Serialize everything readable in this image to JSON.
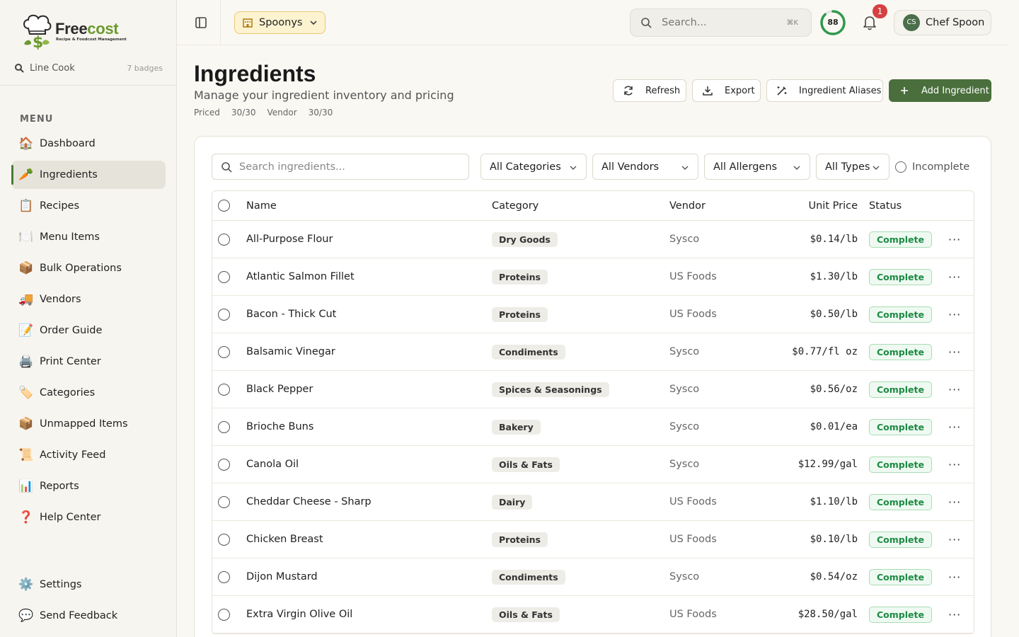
{
  "brand": {
    "name_main": "Free",
    "name_accent": "cost",
    "tagline": "Recipe & Foodcost Management"
  },
  "rank": {
    "label": "Line Cook",
    "badges": "7 badges"
  },
  "menu_label": "MENU",
  "nav": [
    {
      "icon": "🏠",
      "label": "Dashboard",
      "name": "dashboard",
      "active": false
    },
    {
      "icon": "🥕",
      "label": "Ingredients",
      "name": "ingredients",
      "active": true
    },
    {
      "icon": "📋",
      "label": "Recipes",
      "name": "recipes",
      "active": false
    },
    {
      "icon": "🍽️",
      "label": "Menu Items",
      "name": "menu-items",
      "active": false
    },
    {
      "icon": "📦",
      "label": "Bulk Operations",
      "name": "bulk-operations",
      "active": false
    },
    {
      "icon": "🚚",
      "label": "Vendors",
      "name": "vendors",
      "active": false
    },
    {
      "icon": "📝",
      "label": "Order Guide",
      "name": "order-guide",
      "active": false
    },
    {
      "icon": "🖨️",
      "label": "Print Center",
      "name": "print-center",
      "active": false
    },
    {
      "icon": "🏷️",
      "label": "Categories",
      "name": "categories",
      "active": false
    },
    {
      "icon": "📦",
      "label": "Unmapped Items",
      "name": "unmapped-items",
      "active": false
    },
    {
      "icon": "📜",
      "label": "Activity Feed",
      "name": "activity-feed",
      "active": false
    },
    {
      "icon": "📊",
      "label": "Reports",
      "name": "reports",
      "active": false
    },
    {
      "icon": "❓",
      "label": "Help Center",
      "name": "help-center",
      "active": false
    }
  ],
  "nav_bottom": [
    {
      "icon": "⚙️",
      "label": "Settings",
      "name": "settings"
    },
    {
      "icon": "💬",
      "label": "Send Feedback",
      "name": "send-feedback"
    }
  ],
  "topbar": {
    "location": "Spoonys",
    "search_placeholder": "Search...",
    "search_shortcut": "⌘K",
    "score": "88",
    "score_fraction": 0.88,
    "notification_count": "1",
    "user_initials": "CS",
    "user_name": "Chef Spoon"
  },
  "header": {
    "title": "Ingredients",
    "subtitle": "Manage your ingredient inventory and pricing",
    "stats": [
      {
        "label": "Priced",
        "value": "30/30"
      },
      {
        "label": "Vendor",
        "value": "30/30"
      }
    ]
  },
  "actions": {
    "refresh": "Refresh",
    "export": "Export",
    "aliases": "Ingredient Aliases",
    "add": "Add Ingredient"
  },
  "filters": {
    "search_placeholder": "Search ingredients...",
    "categories": "All Categories",
    "vendors": "All Vendors",
    "allergens": "All Allergens",
    "types": "All Types",
    "incomplete": "Incomplete"
  },
  "table": {
    "columns": [
      "Name",
      "Category",
      "Vendor",
      "Unit Price",
      "Status"
    ],
    "rows": [
      {
        "name": "All-Purpose Flour",
        "category": "Dry Goods",
        "vendor": "Sysco",
        "price": "$0.14/lb",
        "status": "Complete"
      },
      {
        "name": "Atlantic Salmon Fillet",
        "category": "Proteins",
        "vendor": "US Foods",
        "price": "$1.30/lb",
        "status": "Complete"
      },
      {
        "name": "Bacon - Thick Cut",
        "category": "Proteins",
        "vendor": "US Foods",
        "price": "$0.50/lb",
        "status": "Complete"
      },
      {
        "name": "Balsamic Vinegar",
        "category": "Condiments",
        "vendor": "Sysco",
        "price": "$0.77/fl oz",
        "status": "Complete"
      },
      {
        "name": "Black Pepper",
        "category": "Spices & Seasonings",
        "vendor": "Sysco",
        "price": "$0.56/oz",
        "status": "Complete"
      },
      {
        "name": "Brioche Buns",
        "category": "Bakery",
        "vendor": "Sysco",
        "price": "$0.01/ea",
        "status": "Complete"
      },
      {
        "name": "Canola Oil",
        "category": "Oils & Fats",
        "vendor": "Sysco",
        "price": "$12.99/gal",
        "status": "Complete"
      },
      {
        "name": "Cheddar Cheese - Sharp",
        "category": "Dairy",
        "vendor": "US Foods",
        "price": "$1.10/lb",
        "status": "Complete"
      },
      {
        "name": "Chicken Breast",
        "category": "Proteins",
        "vendor": "US Foods",
        "price": "$0.10/lb",
        "status": "Complete"
      },
      {
        "name": "Dijon Mustard",
        "category": "Condiments",
        "vendor": "Sysco",
        "price": "$0.54/oz",
        "status": "Complete"
      },
      {
        "name": "Extra Virgin Olive Oil",
        "category": "Oils & Fats",
        "vendor": "US Foods",
        "price": "$28.50/gal",
        "status": "Complete"
      }
    ]
  }
}
